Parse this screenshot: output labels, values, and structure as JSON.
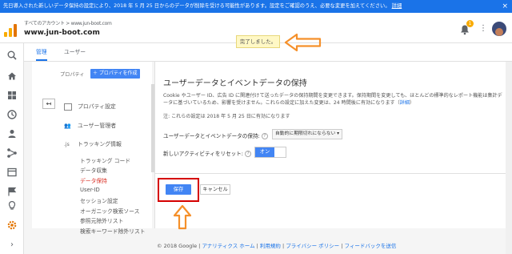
{
  "banner": {
    "text": "先日導入された新しいデータ保持の設定により、2018 年 5 月 25 日からのデータが削除を受ける可能性があります。設定をご確認のうえ、必要な変更を加えてください。",
    "link": "詳細"
  },
  "header": {
    "account_line1": "すべてのアカウント > www.jun-boot.com",
    "account_line2": "www.jun-boot.com",
    "notification_count": "1"
  },
  "toast": {
    "text": "完了しました。"
  },
  "tabs": [
    {
      "label": "管理"
    },
    {
      "label": "ユーザー"
    }
  ],
  "property_col": {
    "label": "プロパティ",
    "create_button": "＋ プロパティを作成",
    "back_glyph": "↤",
    "menu": [
      {
        "label": "プロパティ設定"
      },
      {
        "label": "ユーザー管理者"
      },
      {
        "label": "トラッキング情報",
        "prefix": ".js"
      }
    ],
    "submenu": [
      {
        "label": "トラッキング コード"
      },
      {
        "label": "データ収集"
      },
      {
        "label": "データ保持"
      },
      {
        "label": "User-ID"
      },
      {
        "label": "セッション設定"
      },
      {
        "label": "オーガニック検索ソース"
      },
      {
        "label": "参照元除外リスト"
      },
      {
        "label": "検索キーワード除外リスト"
      }
    ]
  },
  "main": {
    "title": "ユーザーデータとイベントデータの保持",
    "description": "Cookie やユーザー ID、広告 ID に関連付けて送ったデータの保持期間を変更できます。保持期間を変更しても、ほとんどの標準的なレポート機能は集計データに基づいているため、影響を受けません。これらの設定に加えた変更は、24 時間後に有効になります（",
    "description_link": "詳細",
    "description_end": "）",
    "note": "注: これらの設定は 2018 年 5 月 25 日に有効になります",
    "retention_label": "ユーザーデータとイベントデータの保持:",
    "retention_value": "自動的に期限切れにならない",
    "reset_label": "新しいアクティビティをリセット:",
    "reset_toggle": "オン",
    "help_glyph": "?",
    "save_button": "保存",
    "cancel_button": "キャンセル"
  },
  "footer": {
    "copyright": "© 2018 Google |",
    "links": [
      "アナリティクス ホーム",
      "利用規約",
      "プライバシー ポリシー",
      "フィードバックを送信"
    ]
  },
  "colors": {
    "accent": "#4285f4",
    "banner": "#1a73e8",
    "annotation_arrow": "#f5902a",
    "annotation_box": "#d50000",
    "active_submenu": "#d93025"
  }
}
